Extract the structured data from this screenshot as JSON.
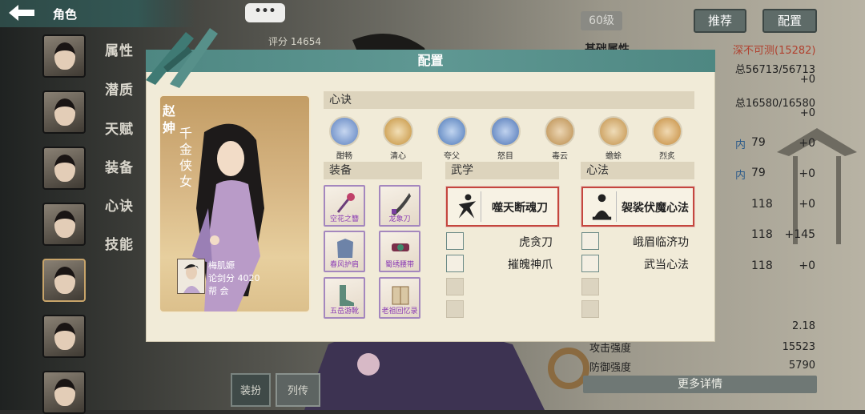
{
  "header": {
    "title": "角色",
    "more": "•••"
  },
  "sidebar": {
    "tabs": [
      "属性",
      "潜质",
      "天赋",
      "装备",
      "心诀",
      "技能"
    ]
  },
  "background": {
    "score_text": "评分 14654",
    "level": "60级",
    "recommend_btn": "推荐",
    "config_btn": "配置",
    "basic_attr_title": "基础属性",
    "difficulty": "深不可测(15282)",
    "hp": "总56713/56713",
    "hp_bonus": "+0",
    "mp": "总16580/16580",
    "mp_bonus": "+0",
    "stats": [
      {
        "label": "内",
        "value": "79",
        "bonus": "+0"
      },
      {
        "label": "内",
        "value": "79",
        "bonus": "+0"
      },
      {
        "label": "",
        "value": "118",
        "bonus": "+0"
      },
      {
        "label": "",
        "value": "118",
        "bonus": "+145"
      },
      {
        "label": "",
        "value": "118",
        "bonus": "+0"
      }
    ],
    "crit": "2.18",
    "attack_label": "攻击强度",
    "attack": "15523",
    "defense_label": "防御强度",
    "defense": "5790",
    "more_details": "更多详情",
    "bottom_tab1": "装扮",
    "bottom_tab2": "列传"
  },
  "dialog": {
    "title": "配置",
    "character": {
      "name": "赵\n妽",
      "nickname": "千金侠女",
      "player_name": "梅肌嫄",
      "player_score": "论剑分 4020",
      "guild": "帮  会"
    },
    "heart_section": "心诀",
    "heart_skills": [
      {
        "name": "酣畅",
        "color": "#5a7fbf"
      },
      {
        "name": "清心",
        "color": "#c4903a"
      },
      {
        "name": "夸父",
        "color": "#4d78b8"
      },
      {
        "name": "怒目",
        "color": "#4b73b5"
      },
      {
        "name": "毒云",
        "color": "#b98b4a"
      },
      {
        "name": "蟾蜍",
        "color": "#c29048"
      },
      {
        "name": "烈炙",
        "color": "#c48a3a"
      }
    ],
    "equip_section": "装备",
    "equipment": [
      {
        "name": "空花之簪"
      },
      {
        "name": "龙象刀"
      },
      {
        "name": "春风护肩"
      },
      {
        "name": "蜀绣腰带"
      },
      {
        "name": "五岳游靴"
      },
      {
        "name": "老祖回忆录"
      }
    ],
    "martial_section": "武学",
    "martial_main": "噬天断魂刀",
    "martial_subs": [
      "虎贪刀",
      "摧魄神爪"
    ],
    "method_section": "心法",
    "method_main": "袈裟伏魔心法",
    "method_subs": [
      "峨眉临济功",
      "武当心法"
    ]
  }
}
